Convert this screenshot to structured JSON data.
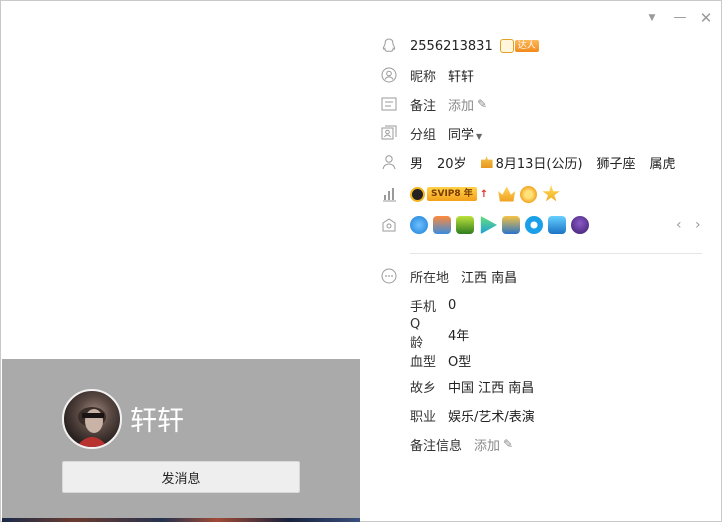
{
  "window": {
    "controls": [
      "menu",
      "minimize",
      "close"
    ]
  },
  "profile": {
    "nickname": "轩轩",
    "send_message_label": "发消息",
    "qq_number": "2556213831",
    "daren_label": "达人"
  },
  "info": {
    "nickname_label": "昵称",
    "nickname_value": "轩轩",
    "remark_label": "备注",
    "remark_value": "添加",
    "group_label": "分组",
    "group_value": "同学",
    "gender": "男",
    "age": "20岁",
    "birthday": "8月13日(公历)",
    "zodiac": "狮子座",
    "chinese_zodiac": "属虎",
    "vip_text": "SVIP8 年",
    "location_label": "所在地",
    "location_value": "江西 南昌",
    "phone_label": "手机",
    "phone_value": "0",
    "qage_label": "Q 龄",
    "qage_value": "4年",
    "blood_label": "血型",
    "blood_value": "O型",
    "hometown_label": "故乡",
    "hometown_value": "中国 江西 南昌",
    "job_label": "职业",
    "job_value": "娱乐/艺术/表演",
    "remark_info_label": "备注信息",
    "remark_info_value": "添加"
  },
  "colors": {
    "gray_panel": "#aaaaaa",
    "text": "#222222",
    "muted": "#8a8a8a",
    "vip_gold": "#f4a11b"
  },
  "icons": [
    "qq-penguin-icon",
    "user-circle-icon",
    "id-card-icon",
    "group-icon",
    "person-icon",
    "chart-icon",
    "tag-home-icon",
    "more-icon",
    "edit-icon"
  ]
}
